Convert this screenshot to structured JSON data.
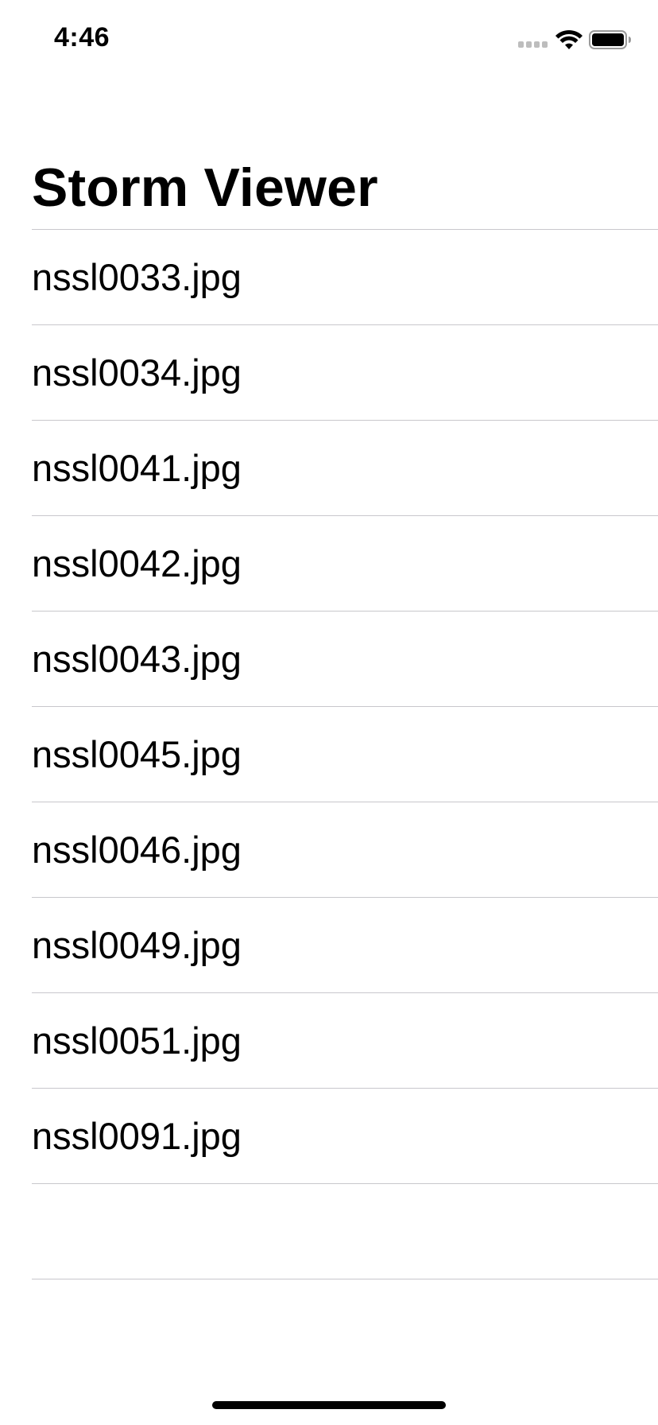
{
  "status_bar": {
    "time": "4:46",
    "icons": [
      "cellular-signal-icon",
      "wifi-icon",
      "battery-icon"
    ]
  },
  "navigation": {
    "title": "Storm Viewer"
  },
  "table": {
    "rows": [
      {
        "label": "nssl0033.jpg"
      },
      {
        "label": "nssl0034.jpg"
      },
      {
        "label": "nssl0041.jpg"
      },
      {
        "label": "nssl0042.jpg"
      },
      {
        "label": "nssl0043.jpg"
      },
      {
        "label": "nssl0045.jpg"
      },
      {
        "label": "nssl0046.jpg"
      },
      {
        "label": "nssl0049.jpg"
      },
      {
        "label": "nssl0051.jpg"
      },
      {
        "label": "nssl0091.jpg"
      },
      {
        "label": ""
      },
      {
        "label": ""
      }
    ]
  },
  "colors": {
    "background": "#ffffff",
    "separator": "#c8c7cc",
    "text": "#000000"
  }
}
